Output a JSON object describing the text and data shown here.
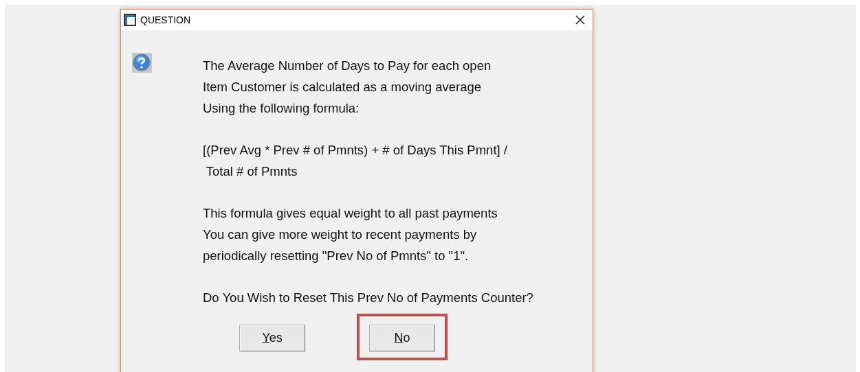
{
  "window": {
    "title": "QUESTION"
  },
  "message": {
    "paragraphs": [
      [
        "The Average Number of Days to Pay for each open",
        "Item Customer is calculated as a moving average",
        "Using the following formula:"
      ],
      [
        "[(Prev Avg * Prev # of Pmnts) + # of Days This Pmnt] /",
        " Total # of Pmnts"
      ],
      [
        "This formula gives equal weight to all past payments",
        "You can give more weight to recent payments by",
        "periodically resetting \"Prev No of Pmnts\" to \"1\"."
      ],
      [
        "Do You Wish to Reset This Prev No of Payments Counter?"
      ]
    ]
  },
  "buttons": [
    {
      "mnemonic": "Y",
      "rest": "es",
      "highlighted": false
    },
    {
      "mnemonic": "N",
      "rest": "o",
      "highlighted": true
    }
  ]
}
